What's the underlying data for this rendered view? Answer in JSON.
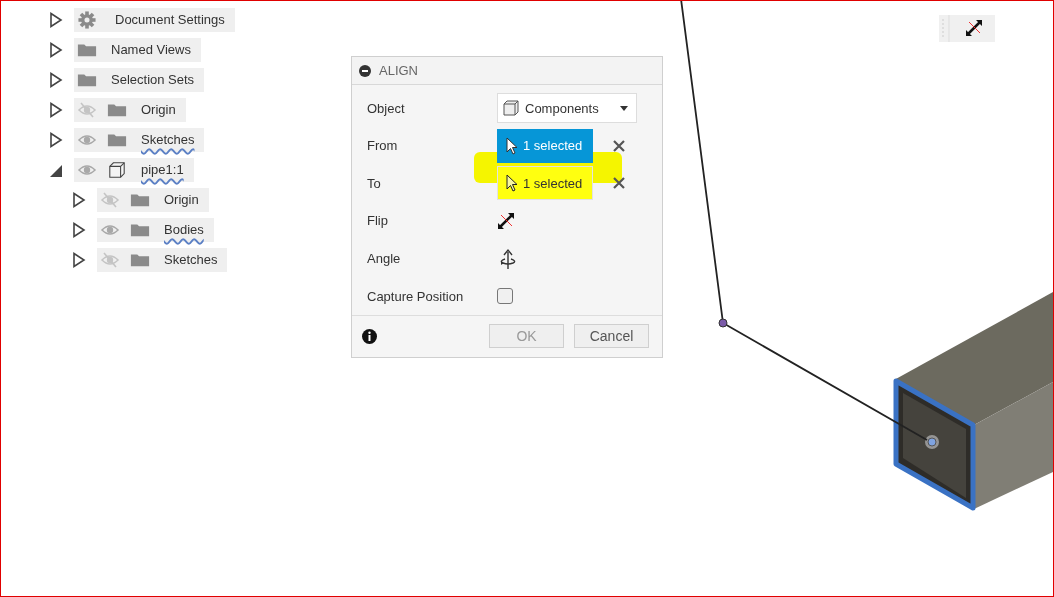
{
  "browser": {
    "items": [
      {
        "kind": "settings",
        "label": "Document Settings",
        "expanded": false,
        "underlined": false
      },
      {
        "kind": "folder",
        "label": "Named Views",
        "expanded": false,
        "underlined": false
      },
      {
        "kind": "folder",
        "label": "Selection Sets",
        "expanded": false,
        "underlined": false
      },
      {
        "kind": "folder",
        "label": "Origin",
        "visible": false,
        "expanded": false,
        "underlined": false
      },
      {
        "kind": "folder",
        "label": "Sketches",
        "visible": true,
        "expanded": false,
        "underlined": true
      },
      {
        "kind": "component",
        "label": "pipe1:1",
        "visible": true,
        "expanded": true,
        "underlined": true,
        "children": [
          {
            "kind": "folder",
            "label": "Origin",
            "visible": false,
            "expanded": false,
            "underlined": false
          },
          {
            "kind": "folder",
            "label": "Bodies",
            "visible": true,
            "expanded": false,
            "underlined": true
          },
          {
            "kind": "folder",
            "label": "Sketches",
            "visible": false,
            "expanded": false,
            "underlined": false
          }
        ]
      }
    ]
  },
  "dialog": {
    "title": "ALIGN",
    "rows": [
      {
        "kind": "dropdown",
        "label": "Object",
        "value": "Components"
      },
      {
        "kind": "selection",
        "label": "From",
        "value": "1 selected",
        "active": true,
        "highlighted": false
      },
      {
        "kind": "selection",
        "label": "To",
        "value": "1 selected",
        "active": false,
        "highlighted": true
      },
      {
        "kind": "flip",
        "label": "Flip"
      },
      {
        "kind": "angle",
        "label": "Angle"
      },
      {
        "kind": "checkbox",
        "label": "Capture Position",
        "checked": false
      }
    ],
    "buttons": [
      {
        "label": "OK",
        "disabled": true
      },
      {
        "label": "Cancel",
        "disabled": false
      }
    ]
  }
}
